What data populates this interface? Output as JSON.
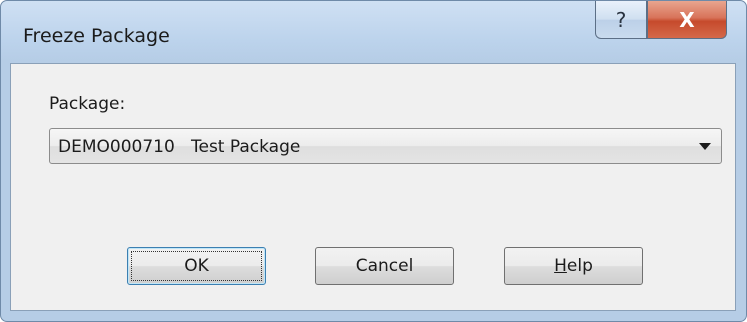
{
  "window": {
    "title": "Freeze Package",
    "help_button_glyph": "?",
    "close_button_glyph": "X"
  },
  "form": {
    "package_label": "Package:",
    "package_value": "DEMO000710   Test Package"
  },
  "buttons": {
    "ok_label": "OK",
    "cancel_label": "Cancel",
    "help_first": "H",
    "help_rest": "elp"
  }
}
